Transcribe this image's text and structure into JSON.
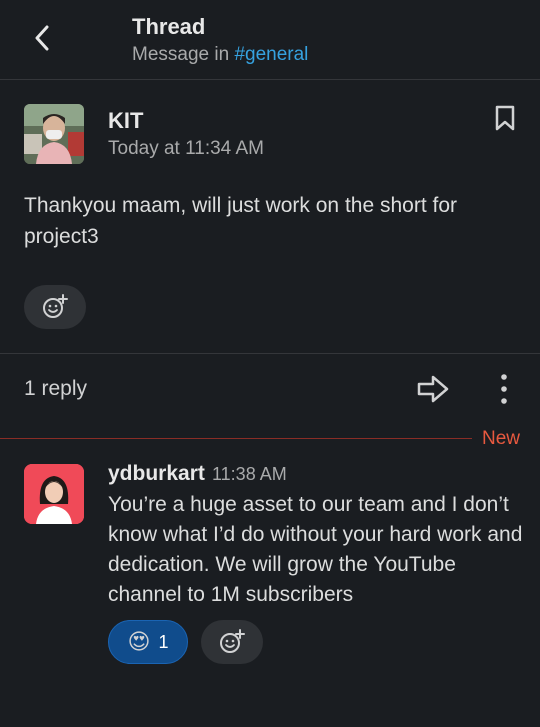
{
  "header": {
    "title": "Thread",
    "subtitle_prefix": "Message in ",
    "channel": "#general"
  },
  "parent_message": {
    "author": "KIT",
    "timestamp": "Today at 11:34 AM",
    "text": "Thankyou maam, will just work on the short for project3"
  },
  "thread": {
    "reply_count": "1 reply",
    "new_label": "New"
  },
  "reply": {
    "author": "ydburkart",
    "timestamp": "11:38 AM",
    "text": "You’re a huge asset to our team and I don’t know what I’d do without your hard work and dedication. We will grow the YouTube channel to 1M subscribers",
    "reaction": {
      "emoji": "😍",
      "count": "1"
    }
  },
  "colors": {
    "background": "#1a1d21",
    "channel_link": "#36a2e0",
    "new_marker": "#e8593f",
    "reaction_selected": "#104c8c"
  },
  "icons": [
    "back-chevron-icon",
    "bookmark-icon",
    "add-reaction-icon",
    "forward-arrow-icon",
    "more-vertical-icon"
  ]
}
